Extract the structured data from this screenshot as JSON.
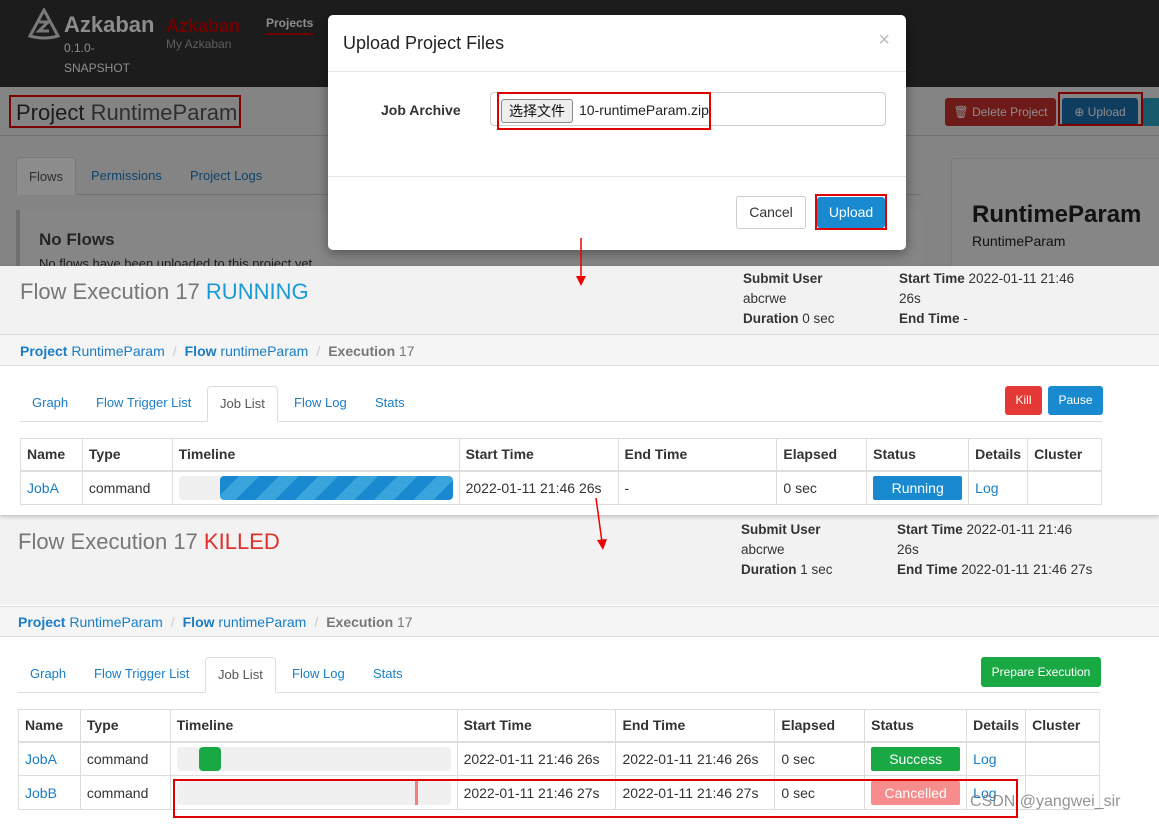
{
  "upload_screen": {
    "brand": "Azkaban",
    "version": "0.1.0-SNAPSHOT",
    "brand_alt": "Azkaban",
    "brand_sub": "My Azkaban",
    "nav_projects": "Projects",
    "project_label": "Project",
    "project_name": "RuntimeParam",
    "tabs": [
      "Flows",
      "Permissions",
      "Project Logs"
    ],
    "no_flows_title": "No Flows",
    "no_flows_text": "No flows have been uploaded to this project yet.",
    "delete_button": "Delete Project",
    "upload_button": "Upload",
    "side_title": "RuntimeParam",
    "side_sub": "RuntimeParam",
    "modal": {
      "title": "Upload Project Files",
      "close": "×",
      "field_label": "Job Archive",
      "choose_file": "选择文件",
      "file_name": "10-runtimeParam.zip",
      "cancel": "Cancel",
      "upload": "Upload"
    }
  },
  "running": {
    "title": "Flow Execution",
    "exec_id": "17",
    "status": "RUNNING",
    "status_color": "#1a9ad6",
    "submit_user_label": "Submit User",
    "submit_user": "abcrwe",
    "duration_label": "Duration",
    "duration": "0 sec",
    "start_time_label": "Start Time",
    "start_time": "2022-01-11 21:46 26s",
    "end_time_label": "End Time",
    "end_time": "-",
    "breadcrumb": {
      "project_label": "Project",
      "project": "RuntimeParam",
      "flow_label": "Flow",
      "flow": "runtimeParam",
      "exec_label": "Execution",
      "exec": "17"
    },
    "tabs": [
      "Graph",
      "Flow Trigger List",
      "Job List",
      "Flow Log",
      "Stats"
    ],
    "kill": "Kill",
    "pause": "Pause",
    "columns": [
      "Name",
      "Type",
      "Timeline",
      "Start Time",
      "End Time",
      "Elapsed",
      "Status",
      "Details",
      "Cluster"
    ],
    "rows": [
      {
        "name": "JobA",
        "type": "command",
        "start": "2022-01-11 21:46 26s",
        "end": "-",
        "elapsed": "0 sec",
        "status": "Running",
        "details": "Log",
        "cluster": "",
        "timeline_start_pct": 15,
        "timeline_end_pct": 100
      }
    ]
  },
  "killed": {
    "title": "Flow Execution",
    "exec_id": "17",
    "status": "KILLED",
    "status_color": "#e0302c",
    "submit_user_label": "Submit User",
    "submit_user": "abcrwe",
    "duration_label": "Duration",
    "duration": "1 sec",
    "start_time_label": "Start Time",
    "start_time": "2022-01-11 21:46 26s",
    "end_time_label": "End Time",
    "end_time": "2022-01-11 21:46 27s",
    "breadcrumb": {
      "project_label": "Project",
      "project": "RuntimeParam",
      "flow_label": "Flow",
      "flow": "runtimeParam",
      "exec_label": "Execution",
      "exec": "17"
    },
    "tabs": [
      "Graph",
      "Flow Trigger List",
      "Job List",
      "Flow Log",
      "Stats"
    ],
    "prepare": "Prepare Execution",
    "columns": [
      "Name",
      "Type",
      "Timeline",
      "Start Time",
      "End Time",
      "Elapsed",
      "Status",
      "Details",
      "Cluster"
    ],
    "rows": [
      {
        "name": "JobA",
        "type": "command",
        "start": "2022-01-11 21:46 26s",
        "end": "2022-01-11 21:46 26s",
        "elapsed": "0 sec",
        "status": "Success",
        "details": "Log",
        "cluster": ""
      },
      {
        "name": "JobB",
        "type": "command",
        "start": "2022-01-11 21:46 27s",
        "end": "2022-01-11 21:46 27s",
        "elapsed": "0 sec",
        "status": "Cancelled",
        "details": "Log",
        "cluster": ""
      }
    ]
  },
  "watermark": "CSDN @yangwei_sir"
}
